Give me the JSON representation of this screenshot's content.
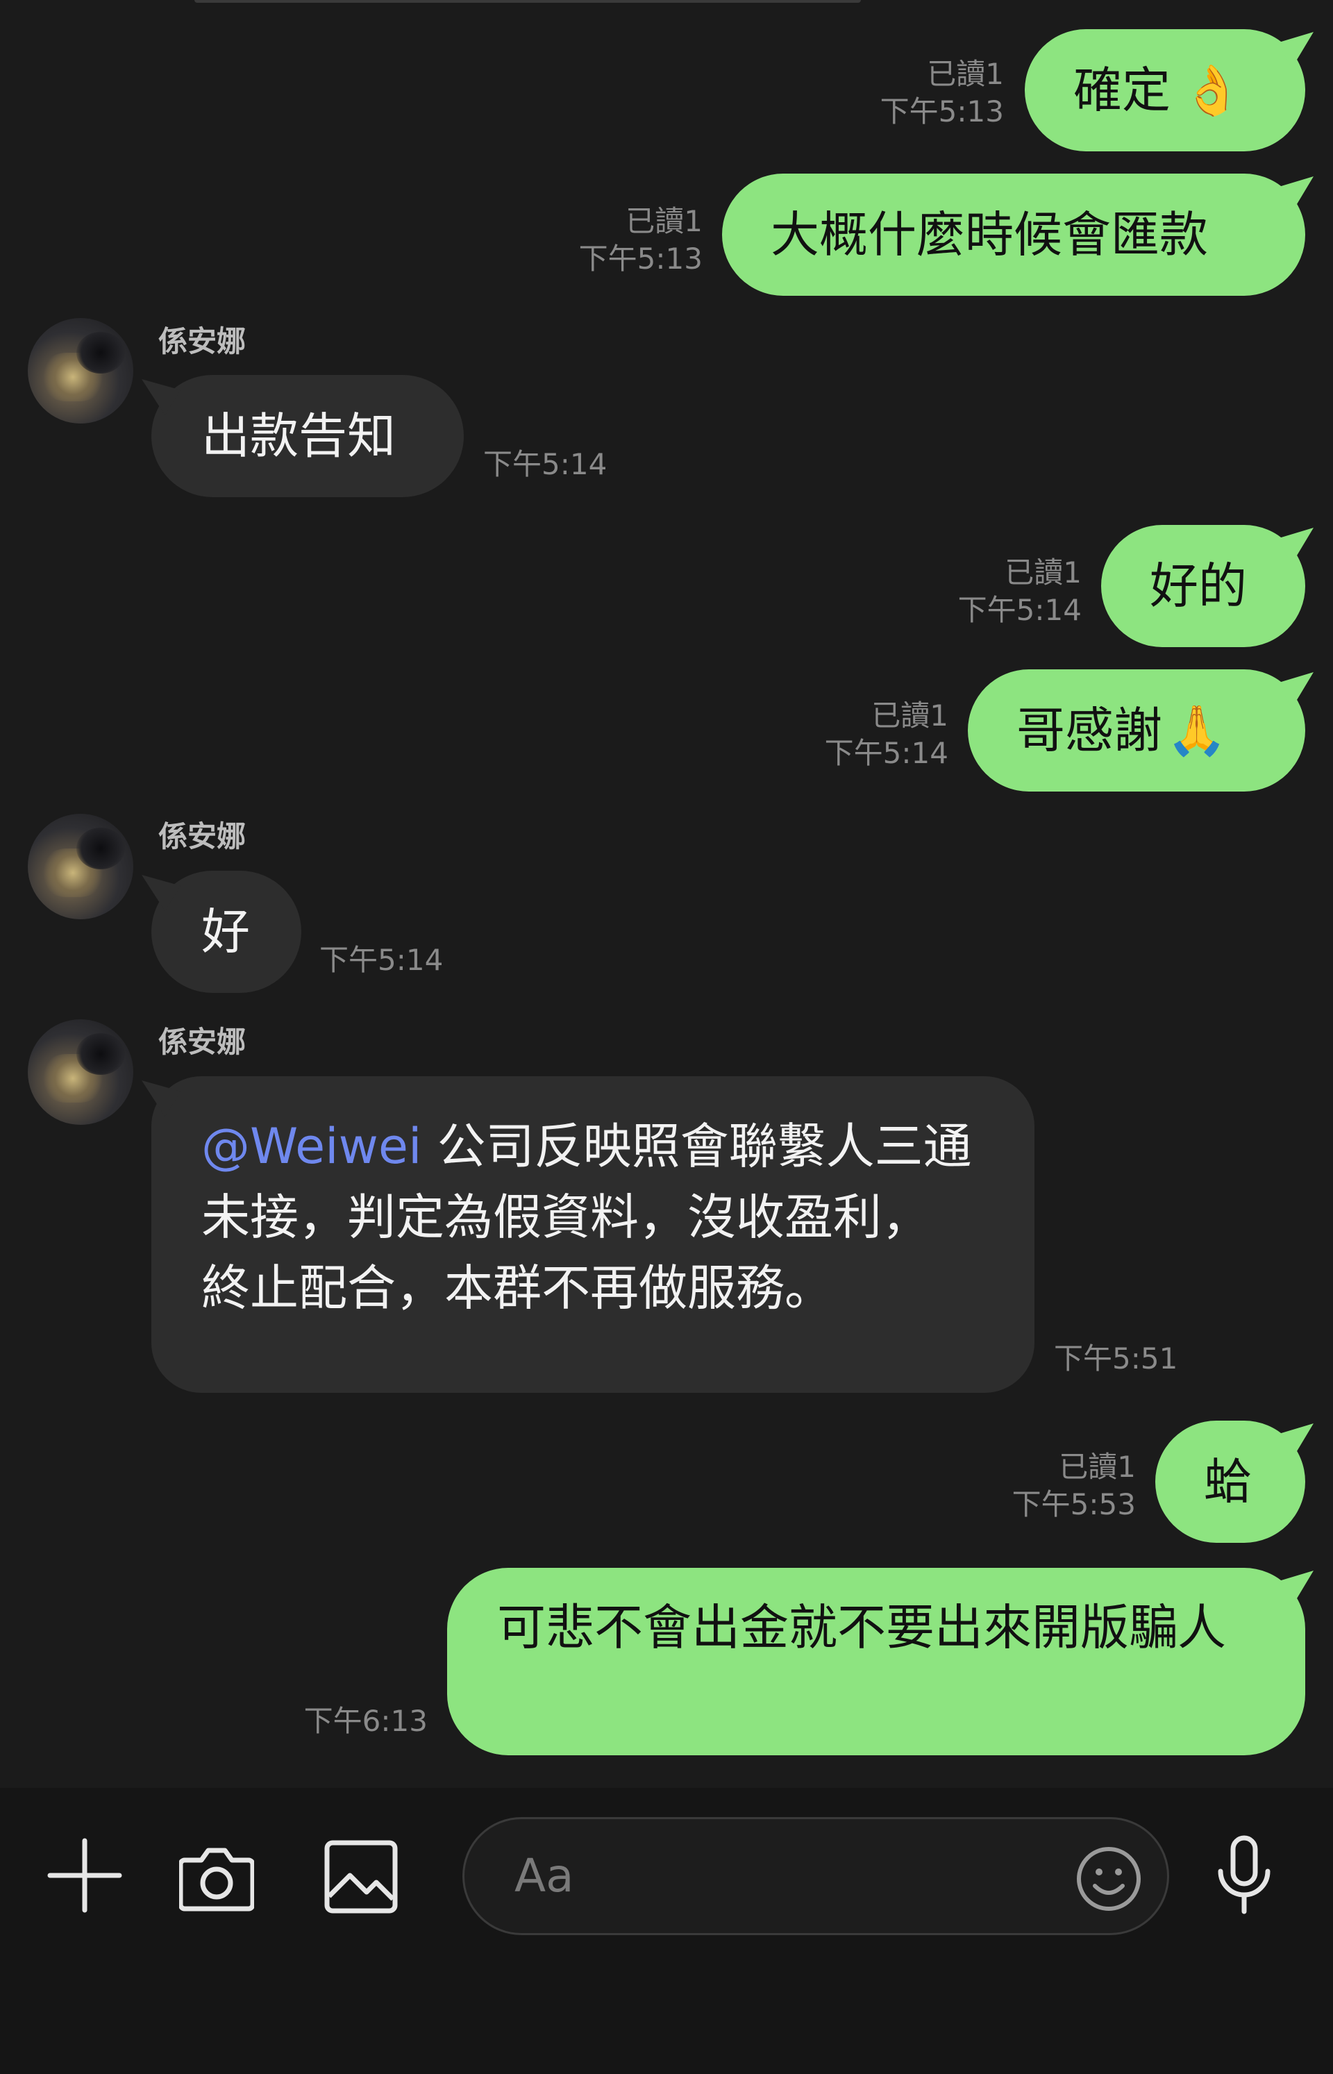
{
  "messages": [
    {
      "side": "sent",
      "text": "確定",
      "emoji": "👌",
      "read": "已讀1",
      "time": "下午5:13"
    },
    {
      "side": "sent",
      "text": "大概什麼時候會匯款",
      "read": "已讀1",
      "time": "下午5:13"
    },
    {
      "side": "recv",
      "sender": "係安娜",
      "text": "出款告知",
      "time": "下午5:14"
    },
    {
      "side": "sent",
      "text": "好的",
      "read": "已讀1",
      "time": "下午5:14"
    },
    {
      "side": "sent",
      "text": "哥感謝",
      "emoji": "🙏",
      "read": "已讀1",
      "time": "下午5:14"
    },
    {
      "side": "recv",
      "sender": "係安娜",
      "text": "好",
      "time": "下午5:14"
    },
    {
      "side": "recv",
      "sender": "係安娜",
      "mention": "@Weiwei",
      "text": " 公司反映照會聯繫人三通未接，判定為假資料，沒收盈利，終止配合，本群不再做服務。",
      "time": "下午5:51"
    },
    {
      "side": "sent",
      "text": "蛤",
      "read": "已讀1",
      "time": "下午5:53"
    },
    {
      "side": "sent",
      "text": "可悲不會出金就不要出來開版騙人",
      "time": "下午6:13"
    }
  ],
  "input": {
    "placeholder": "Aa"
  },
  "icons": {
    "add": "plus-icon",
    "camera": "camera-icon",
    "gallery": "image-icon",
    "emoji": "emoji-icon",
    "mic": "microphone-icon"
  },
  "colors": {
    "sent_bubble": "#8de480",
    "recv_bubble": "#2d2d2d",
    "mention": "#6f88ee",
    "background": "#1b1b1b"
  }
}
